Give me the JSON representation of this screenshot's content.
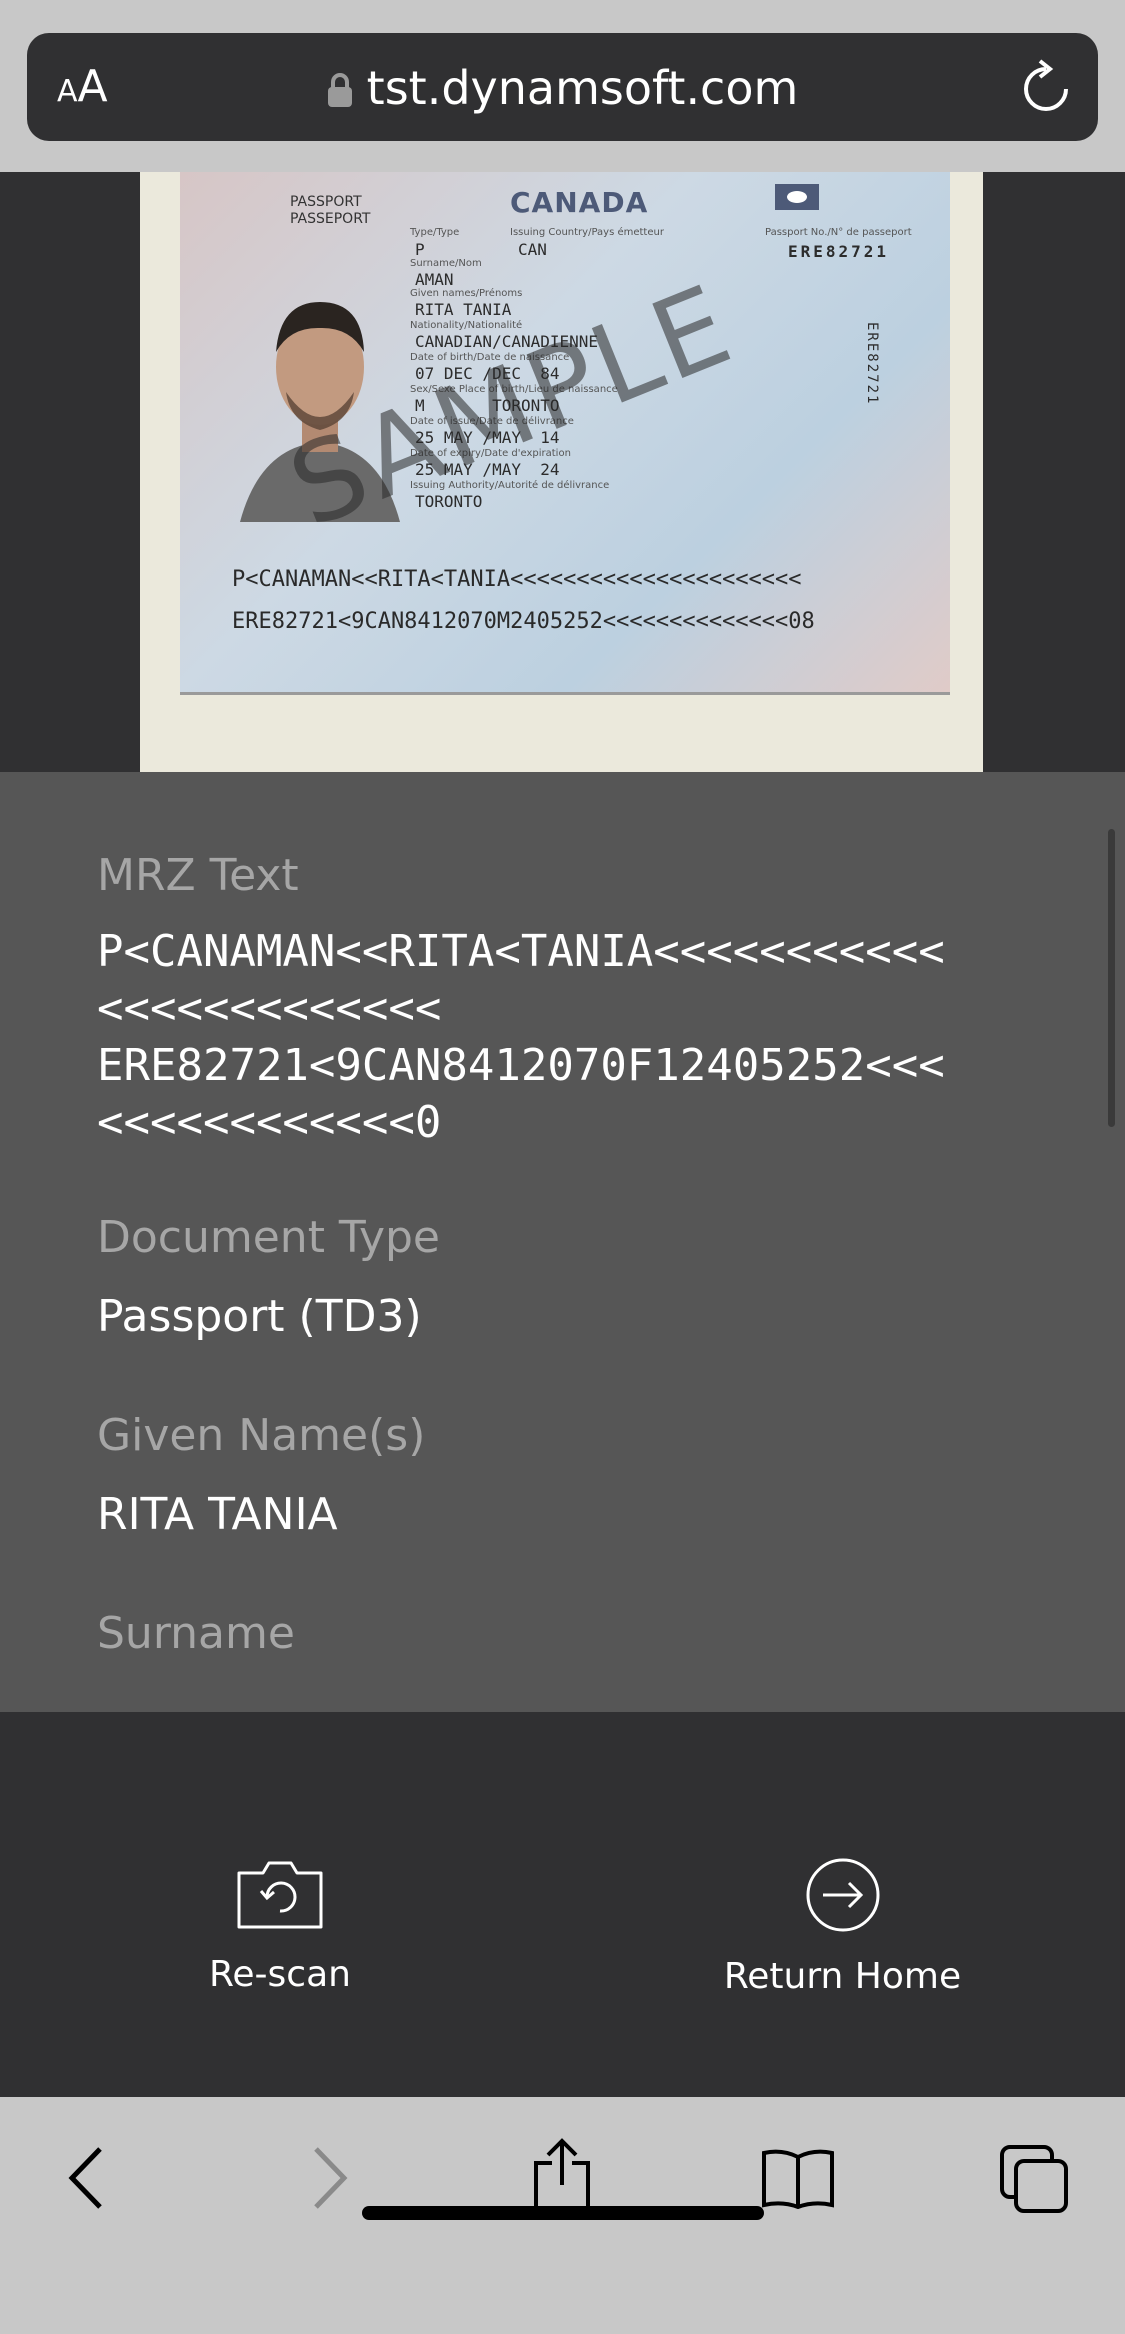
{
  "browser": {
    "text_size_label_small": "A",
    "text_size_label_big": "A",
    "url": "tst.dynamsoft.com",
    "icons": [
      "lock-icon",
      "reload-icon"
    ]
  },
  "passport_image": {
    "country": "CANADA",
    "doc_label_en": "PASSPORT",
    "doc_label_fr": "PASSEPORT",
    "type_label": "Type/Type",
    "type": "P",
    "issuing_label": "Issuing Country/Pays émetteur",
    "issuing": "CAN",
    "passno_label": "Passport No./N° de passeport",
    "passno": "ERE82721",
    "surname_label": "Surname/Nom",
    "surname": "AMAN",
    "given_label": "Given names/Prénoms",
    "given": "RITA TANIA",
    "nationality_label": "Nationality/Nationalité",
    "nationality": "CANADIAN/CANADIENNE",
    "dob_label": "Date of birth/Date de naissance",
    "dob": "07 DEC /DEC  84",
    "sex_label": "Sex/Sexe   Place of birth/Lieu de naissance",
    "sex_place": "M       TORONTO",
    "issue_label": "Date of issue/Date de délivrance",
    "issue": "25 MAY /MAY  14",
    "expiry_label": "Date of expiry/Date d'expiration",
    "expiry": "25 MAY /MAY  24",
    "authority_label": "Issuing Authority/Autorité de délivrance",
    "authority": "TORONTO",
    "watermark": "SAMPLE",
    "side_number": "ERE82721",
    "mrz_line1": "P<CANAMAN<<RITA<TANIA<<<<<<<<<<<<<<<<<<<<<<",
    "mrz_line2": "ERE82721<9CAN8412070M2405252<<<<<<<<<<<<<<08"
  },
  "result": {
    "fields": [
      {
        "label": "MRZ Text",
        "value": "P<CANAMAN<<RITA<TANIA<<<<<<<<<<<\n<<<<<<<<<<<<<\nERE82721<9CAN8412070F12405252<<<\n<<<<<<<<<<<<0"
      },
      {
        "label": "Document Type",
        "value": "Passport (TD3)"
      },
      {
        "label": "Given Name(s)",
        "value": "RITA TANIA"
      },
      {
        "label": "Surname",
        "value": ""
      }
    ]
  },
  "actions": {
    "rescan_label": "Re-scan",
    "home_label": "Return Home"
  },
  "toolbar": {
    "icons": [
      "back-icon",
      "forward-icon",
      "share-icon",
      "bookmarks-icon",
      "tabs-icon"
    ]
  }
}
